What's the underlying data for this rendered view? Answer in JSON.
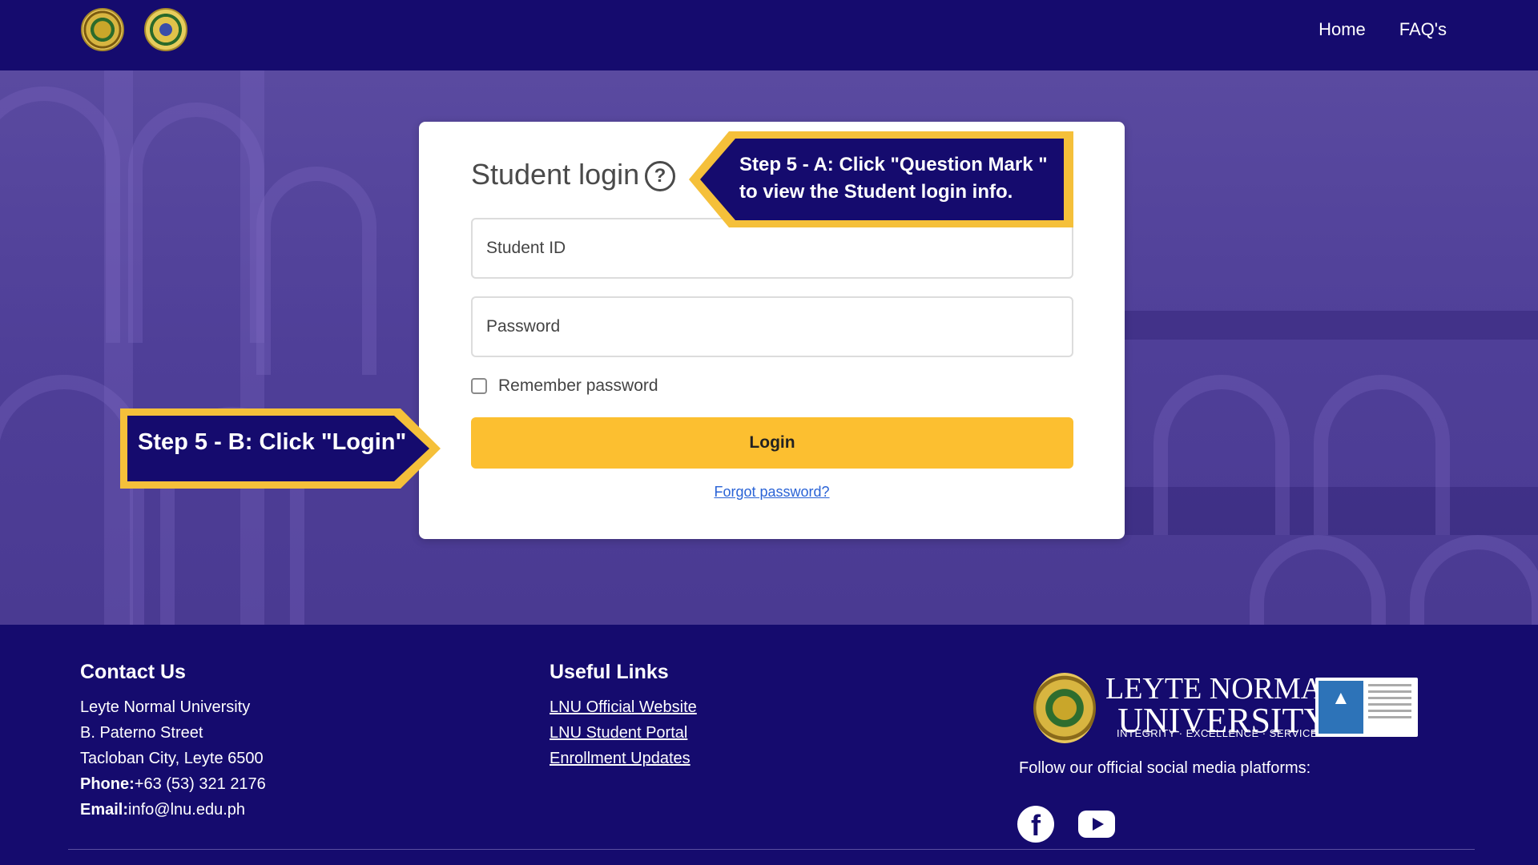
{
  "header": {
    "nav": [
      {
        "label": "Home"
      },
      {
        "label": "FAQ's"
      }
    ]
  },
  "login": {
    "title": "Student login",
    "help_icon": "question-mark-circle-icon",
    "student_id_placeholder": "Student ID",
    "password_placeholder": "Password",
    "remember_label": "Remember password",
    "login_button": "Login",
    "forgot_link": "Forgot password?"
  },
  "callouts": {
    "step_a_line1": "Step 5 - A: Click \"Question Mark \"",
    "step_a_line2": "to view the Student login info.",
    "step_b": "Step 5 - B: Click \"Login\""
  },
  "footer": {
    "contact_title": "Contact Us",
    "contact_lines": [
      "Leyte Normal University",
      "B. Paterno Street",
      "Tacloban City, Leyte 6500"
    ],
    "phone_label": "Phone:",
    "phone_value": "+63 (53) 321 2176",
    "email_label": "Email:",
    "email_value": "info@lnu.edu.ph",
    "links_title": "Useful Links",
    "links": [
      "LNU Official Website",
      "LNU Student Portal",
      "Enrollment Updates"
    ],
    "logo_line1": "LEYTE NORMAL",
    "logo_line2": "UNIVERSITY",
    "logo_tagline": "INTEGRITY · EXCELLENCE · SERVICE",
    "follow_text": "Follow our official social media platforms:",
    "social": [
      "facebook-icon",
      "youtube-icon"
    ]
  },
  "colors": {
    "navy": "#150b6e",
    "accent_yellow": "#fcbf30",
    "hero_purple": "#4f3f98",
    "link_blue": "#2a63d6"
  }
}
